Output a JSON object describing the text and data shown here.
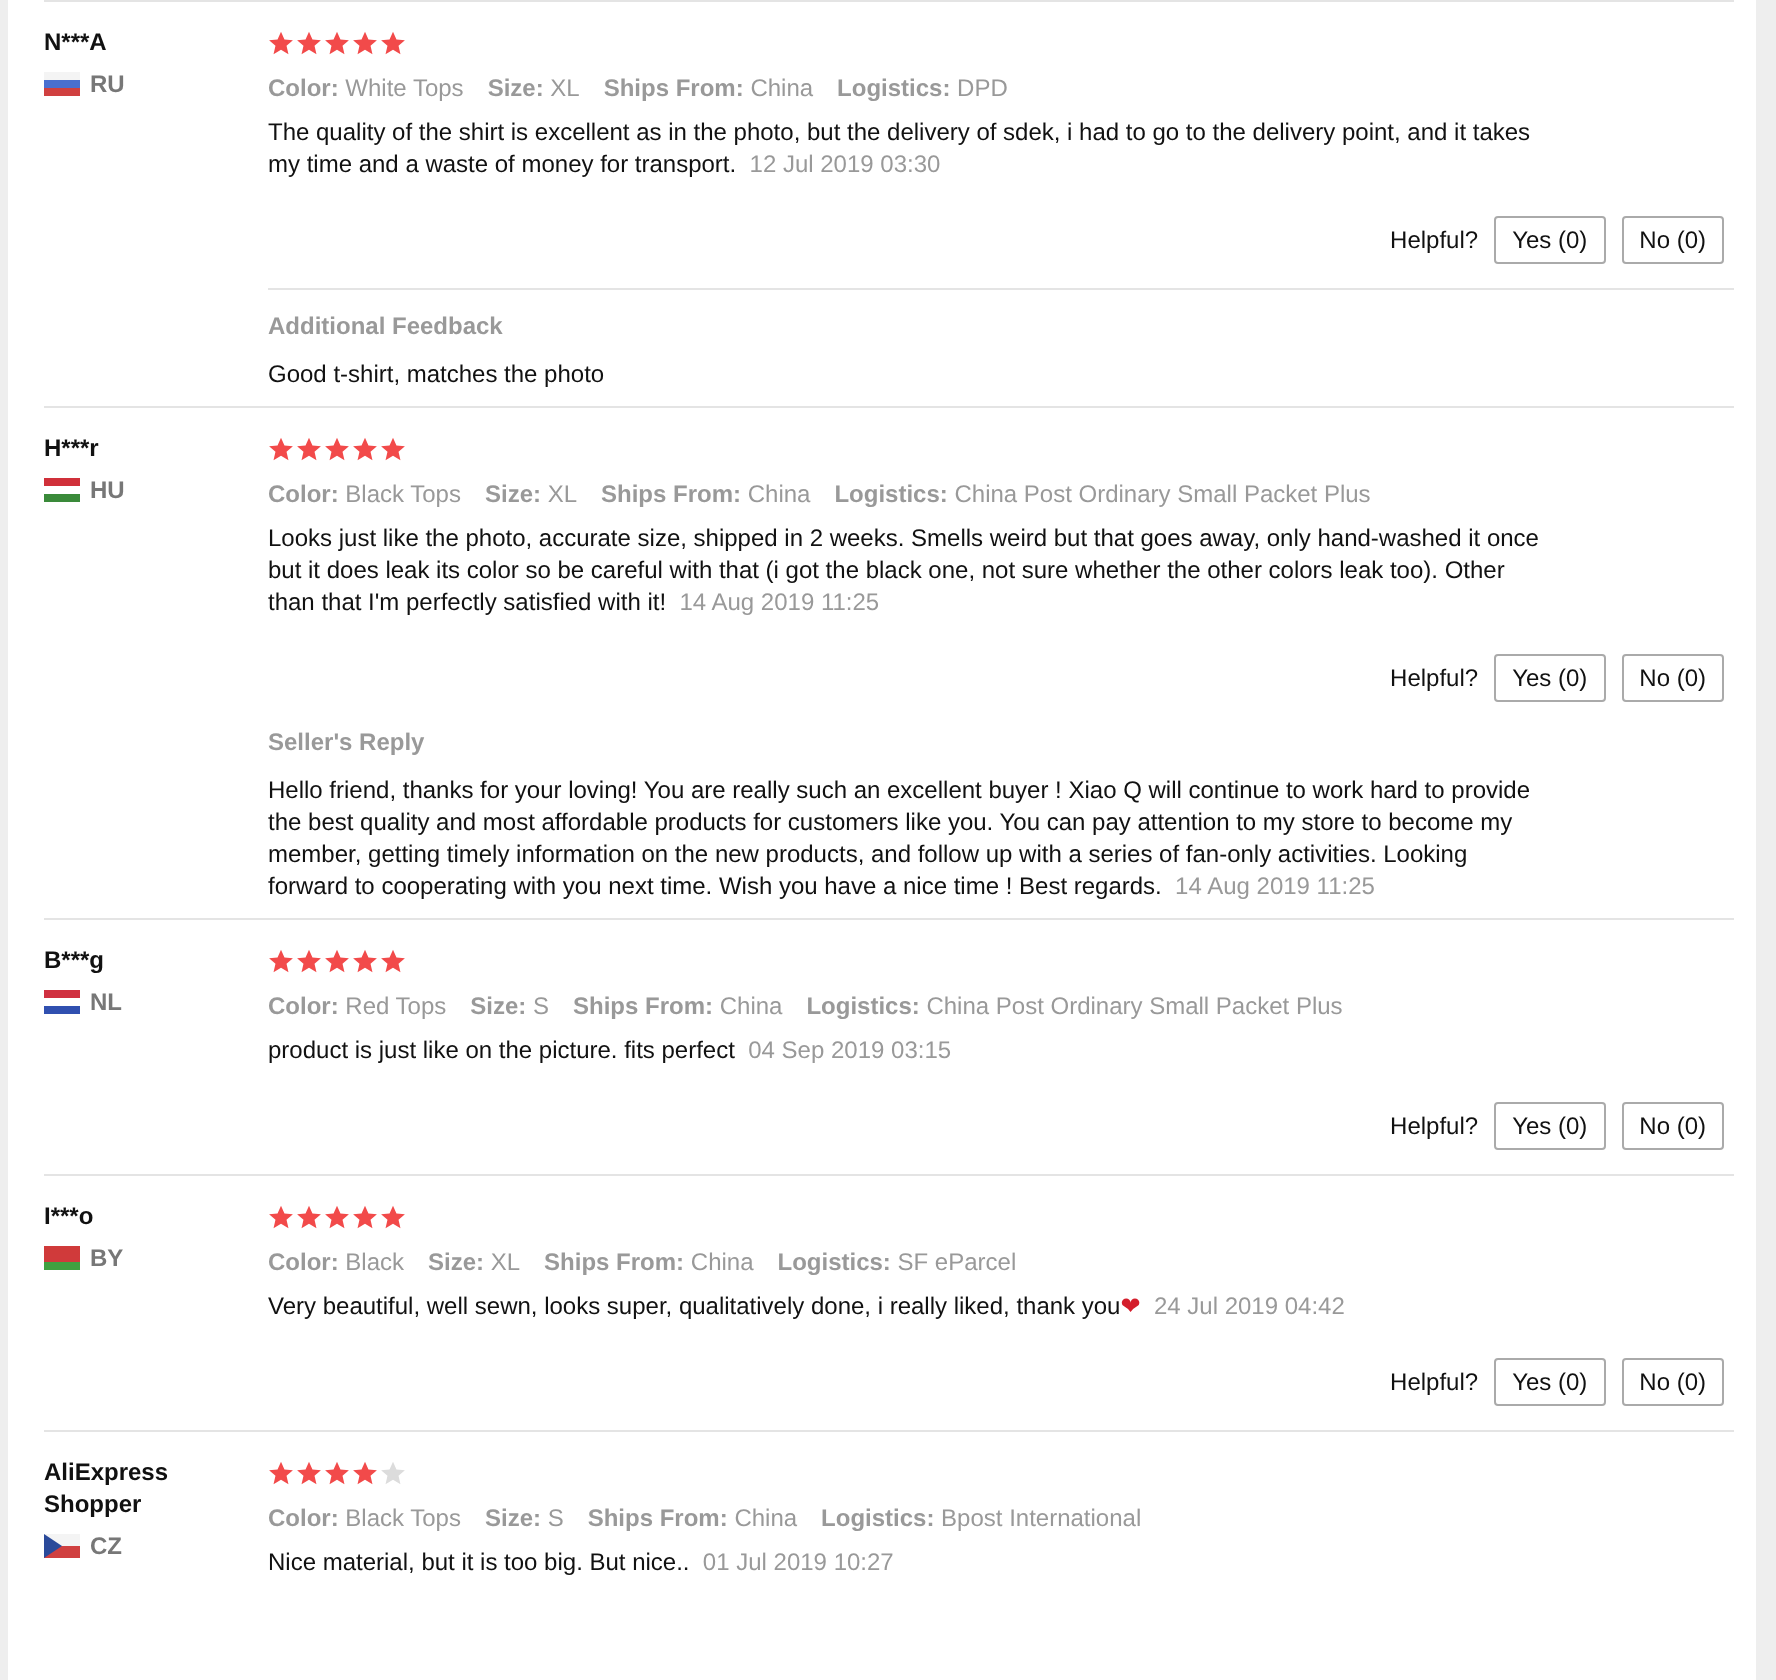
{
  "reviews": [
    {
      "name": "N***A",
      "country": "RU",
      "flag": {
        "kind": "stripes",
        "parts": [
          {
            "color": "#f4f4f4"
          },
          {
            "color": "#4a6fd0"
          },
          {
            "color": "#d04040"
          }
        ]
      },
      "stars": 5,
      "attributes": [
        {
          "label": "Color:",
          "value": "White Tops"
        },
        {
          "label": "Size:",
          "value": "XL"
        },
        {
          "label": "Ships From:",
          "value": "China"
        },
        {
          "label": "Logistics:",
          "value": "DPD"
        }
      ],
      "text": "The quality of the shirt is excellent as in the photo, but the delivery of sdek, i had to go to the delivery point, and it takes my time and a waste of money for transport.",
      "date": "12 Jul 2019 03:30",
      "helpful_label": "Helpful?",
      "yes": "Yes (0)",
      "no": "No (0)",
      "extra": {
        "kind": "additional_feedback",
        "title": "Additional Feedback",
        "text": "Good t-shirt, matches the photo"
      }
    },
    {
      "name": "H***r",
      "country": "HU",
      "flag": {
        "kind": "stripes",
        "parts": [
          {
            "color": "#d0303a"
          },
          {
            "color": "#ffffff"
          },
          {
            "color": "#3a8a3a"
          }
        ]
      },
      "stars": 5,
      "attributes": [
        {
          "label": "Color:",
          "value": "Black Tops"
        },
        {
          "label": "Size:",
          "value": "XL"
        },
        {
          "label": "Ships From:",
          "value": "China"
        },
        {
          "label": "Logistics:",
          "value": "China Post Ordinary Small Packet Plus"
        }
      ],
      "text": "Looks just like the photo, accurate size, shipped in 2 weeks. Smells weird but that goes away, only hand-washed it once but it does leak its color so be careful with that (i got the black one, not sure whether the other colors leak too). Other than that I'm perfectly satisfied with it!",
      "date": "14 Aug 2019 11:25",
      "helpful_label": "Helpful?",
      "yes": "Yes (0)",
      "no": "No (0)",
      "extra": {
        "kind": "seller_reply",
        "title": "Seller's Reply",
        "text": "Hello friend, thanks for your loving! You are really such an excellent buyer ! Xiao Q will continue to work hard to provide the best quality and most affordable products for customers like you. You can pay attention to my store to become my member, getting timely information on the new products, and follow up with a series of fan-only activities. Looking forward to cooperating with you next time. Wish you have a nice time ! Best regards.",
        "date": "14 Aug 2019 11:25"
      }
    },
    {
      "name": "B***g",
      "country": "NL",
      "flag": {
        "kind": "stripes",
        "parts": [
          {
            "color": "#d03040"
          },
          {
            "color": "#ffffff"
          },
          {
            "color": "#3050b0"
          }
        ]
      },
      "stars": 5,
      "attributes": [
        {
          "label": "Color:",
          "value": "Red Tops"
        },
        {
          "label": "Size:",
          "value": "S"
        },
        {
          "label": "Ships From:",
          "value": "China"
        },
        {
          "label": "Logistics:",
          "value": "China Post Ordinary Small Packet Plus"
        }
      ],
      "text": "product is just like on the picture. fits perfect",
      "date": "04 Sep 2019 03:15",
      "helpful_label": "Helpful?",
      "yes": "Yes (0)",
      "no": "No (0)"
    },
    {
      "name": "I***o",
      "country": "BY",
      "flag": {
        "kind": "stripes",
        "parts": [
          {
            "color": "#d03a3a"
          },
          {
            "color": "#d03a3b"
          },
          {
            "color": "#40a040"
          }
        ]
      },
      "stars": 5,
      "attributes": [
        {
          "label": "Color:",
          "value": "Black"
        },
        {
          "label": "Size:",
          "value": "XL"
        },
        {
          "label": "Ships From:",
          "value": "China"
        },
        {
          "label": "Logistics:",
          "value": "SF eParcel"
        }
      ],
      "text": "Very beautiful, well sewn, looks super, qualitatively done, i really liked, thank you",
      "emoji": "❤",
      "date": "24 Jul 2019 04:42",
      "helpful_label": "Helpful?",
      "yes": "Yes (0)",
      "no": "No (0)"
    },
    {
      "name": "AliExpress Shopper",
      "country": "CZ",
      "flag": {
        "kind": "triangle",
        "parts": [
          {
            "color": "#f4f4f4"
          },
          {
            "color": "#d04040"
          },
          {
            "color": "#2a4a9a"
          }
        ]
      },
      "stars": 4,
      "attributes": [
        {
          "label": "Color:",
          "value": "Black Tops"
        },
        {
          "label": "Size:",
          "value": "S"
        },
        {
          "label": "Ships From:",
          "value": "China"
        },
        {
          "label": "Logistics:",
          "value": "Bpost International"
        }
      ],
      "text": "Nice material, but it is too big. But nice..",
      "date": "01 Jul 2019 10:27"
    }
  ]
}
